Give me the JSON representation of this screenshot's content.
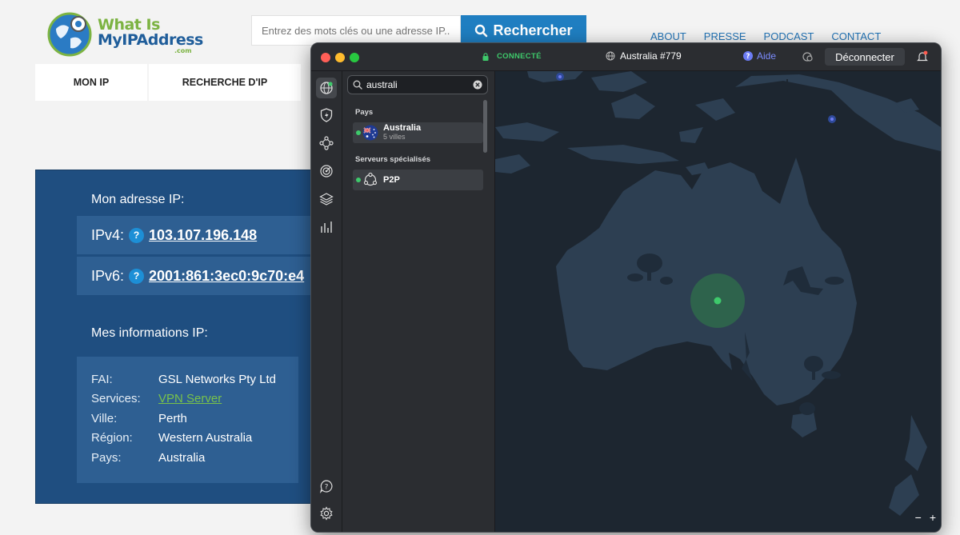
{
  "site": {
    "logo_line1": "What Is",
    "logo_line2": "MyIPAddress",
    "logo_line3": ".com",
    "search_placeholder": "Entrez des mots clés ou une adresse IP...",
    "search_button": "Rechercher",
    "top_nav": [
      "ABOUT",
      "PRESSE",
      "PODCAST",
      "CONTACT"
    ],
    "tabs": [
      "MON IP",
      "RECHERCHE D'IP"
    ],
    "ip_heading": "Mon adresse IP:",
    "ipv4_label": "IPv4:",
    "ipv4_value": "103.107.196.148",
    "ipv6_label": "IPv6:",
    "ipv6_value": "2001:861:3ec0:9c70:e4",
    "info_heading": "Mes informations IP:",
    "info": [
      {
        "key": "FAI:",
        "value": "GSL Networks Pty Ltd"
      },
      {
        "key": "Services:",
        "value": "VPN Server"
      },
      {
        "key": "Ville:",
        "value": "Perth"
      },
      {
        "key": "Région:",
        "value": "Western Australia"
      },
      {
        "key": "Pays:",
        "value": "Australia"
      }
    ]
  },
  "vpn": {
    "status": "CONNECTÉ",
    "server": "Australia #779",
    "help": "Aide",
    "disconnect": "Déconnecter",
    "search_value": "australi",
    "section_countries": "Pays",
    "country_name": "Australia",
    "country_sub": "5 villes",
    "section_special": "Serveurs spécialisés",
    "special_name": "P2P",
    "zoom_out": "−",
    "zoom_in": "+"
  },
  "colors": {
    "site_accent": "#1f7ec1",
    "ip_panel": "#1f4e80",
    "vpn_bg": "#1f2429",
    "connected_green": "#3ec96b",
    "map_land": "#2d3f52",
    "map_sea": "#1d2630"
  }
}
